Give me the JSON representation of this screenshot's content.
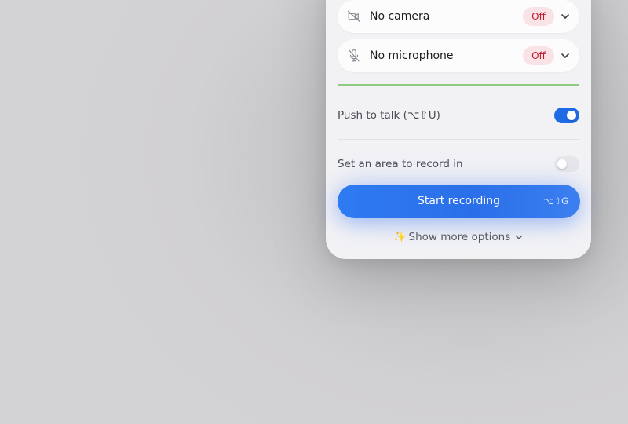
{
  "devices": {
    "camera": {
      "label": "No camera",
      "status": "Off",
      "icon": "camera-off-icon"
    },
    "microphone": {
      "label": "No microphone",
      "status": "Off",
      "icon": "microphone-off-icon"
    }
  },
  "settings": {
    "push_to_talk": {
      "label": "Push to talk (⌥⇧U)",
      "enabled": true
    },
    "record_area": {
      "label": "Set an area to record in",
      "enabled": false
    }
  },
  "start_button": {
    "label": "Start recording",
    "shortcut": "⌥⇧G"
  },
  "more_options": {
    "label": "Show more options",
    "icon": "sparkles-icon"
  },
  "colors": {
    "accent": "#2a6fe9",
    "off_badge_bg": "#fae3e6",
    "off_badge_text": "#c2182e",
    "audio_level": "#8fcb82"
  }
}
